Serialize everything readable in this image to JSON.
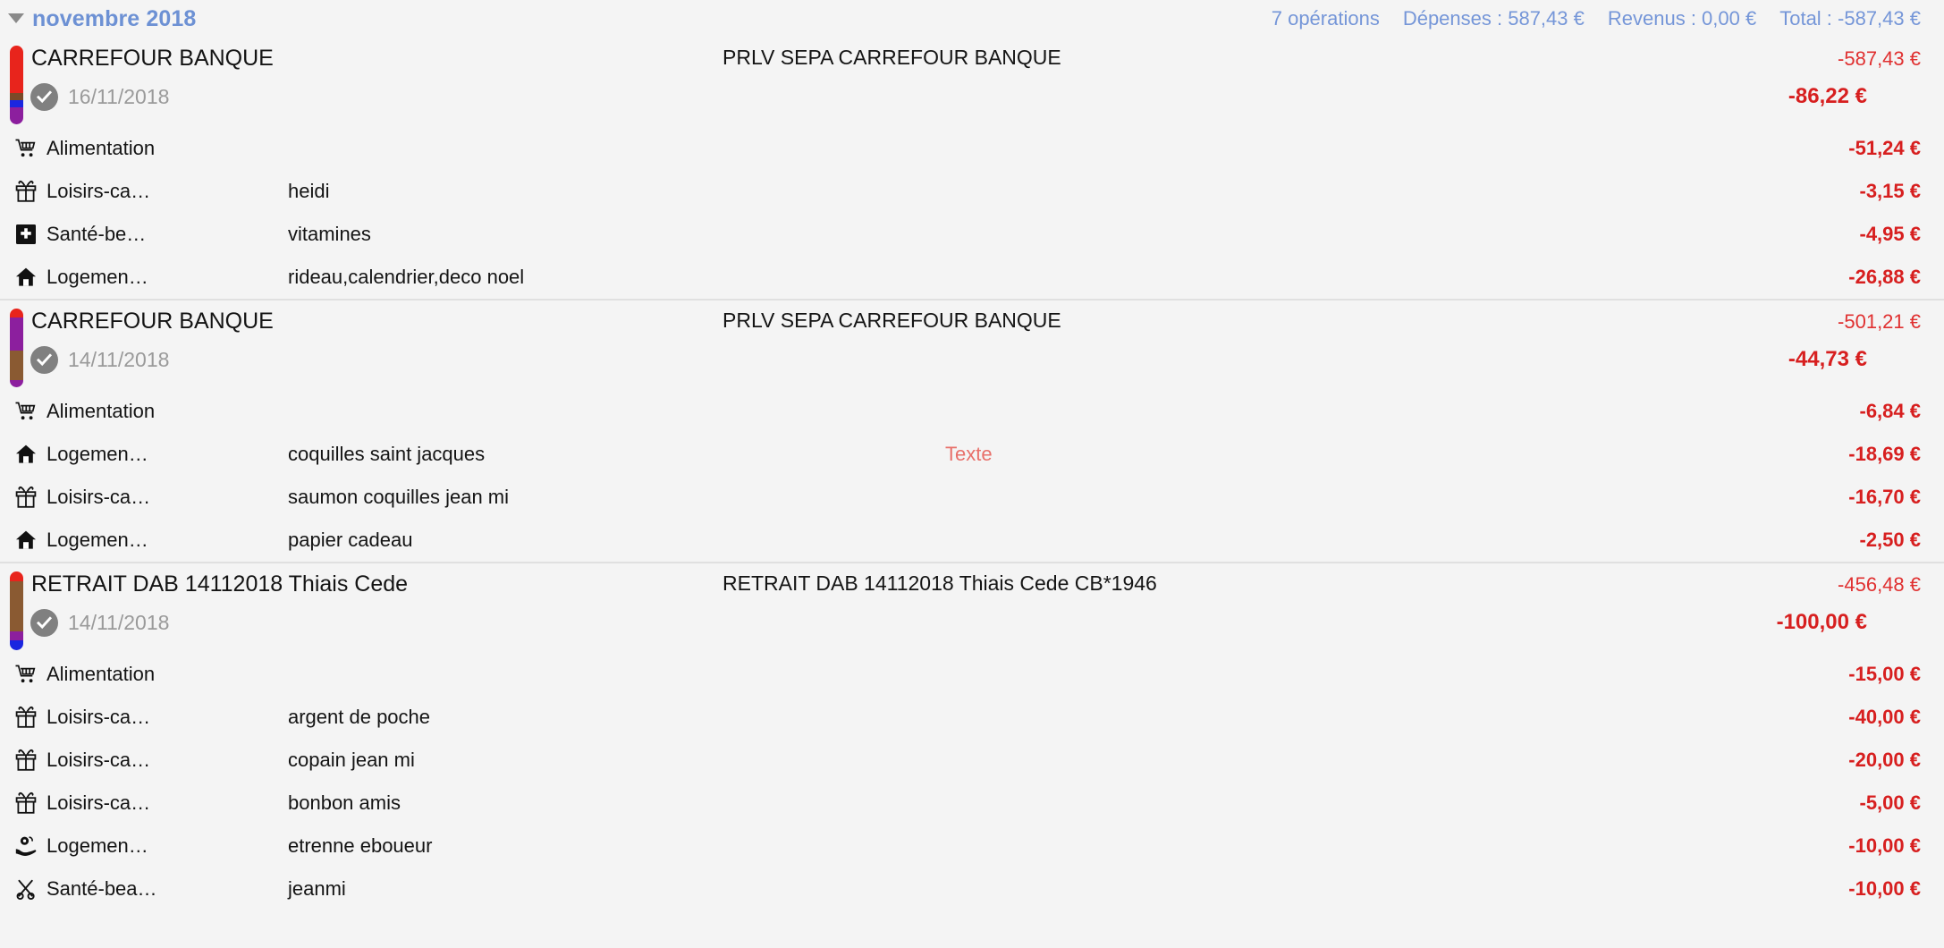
{
  "header": {
    "disclosure_icon": "triangle-down-icon",
    "month_label": "novembre 2018",
    "operations_count": "7 opérations",
    "expenses": "Dépenses : 587,43 €",
    "revenues": "Revenus : 0,00 €",
    "total": "Total : -587,43 €",
    "accent_color": "#7596d8"
  },
  "colors": {
    "background": "#f4f4f4",
    "negative_amount": "#d71f1f",
    "negative_amount_light": "#e03030",
    "date_text": "#9a9a9a",
    "separator": "#e0e0e0",
    "texte_marker": "#e8706a",
    "stripe_red": "#e8241c",
    "stripe_brown": "#8a5a32",
    "stripe_blue": "#1a26e0",
    "stripe_purple": "#8c1f9e"
  },
  "transactions": [
    {
      "label": "CARREFOUR BANQUE",
      "status_icon": "check-circle-icon",
      "date": "16/11/2018",
      "memo": "PRLV SEPA CARREFOUR BANQUE",
      "amount_top": "-587,43 €",
      "amount_main": "-86,22 €",
      "stripe": [
        {
          "color": "#e8241c",
          "pct": 60
        },
        {
          "color": "#7a4a28",
          "pct": 9
        },
        {
          "color": "#1a26e0",
          "pct": 9
        },
        {
          "color": "#8c1f9e",
          "pct": 22
        }
      ],
      "rows": [
        {
          "icon": "shopping-cart-icon",
          "category": "Alimentation",
          "note": "",
          "amount": "-51,24 €"
        },
        {
          "icon": "gift-icon",
          "category": "Loisirs-ca…",
          "note": "heidi",
          "amount": "-3,15 €"
        },
        {
          "icon": "medical-cross-icon",
          "category": "Santé-be…",
          "note": "vitamines",
          "amount": "-4,95 €"
        },
        {
          "icon": "house-icon",
          "category": "Logemen…",
          "note": "rideau,calendrier,deco noel",
          "amount": "-26,88 €"
        }
      ]
    },
    {
      "label": "CARREFOUR BANQUE",
      "status_icon": "check-circle-icon",
      "date": "14/11/2018",
      "memo": "PRLV SEPA CARREFOUR BANQUE",
      "amount_top": "-501,21 €",
      "amount_main": "-44,73 €",
      "stripe": [
        {
          "color": "#e8241c",
          "pct": 11
        },
        {
          "color": "#8c1f9e",
          "pct": 42
        },
        {
          "color": "#8a5a32",
          "pct": 38
        },
        {
          "color": "#8c1f9e",
          "pct": 9
        }
      ],
      "rows": [
        {
          "icon": "shopping-cart-icon",
          "category": "Alimentation",
          "note": "",
          "amount": "-6,84 €"
        },
        {
          "icon": "house-icon",
          "category": "Logemen…",
          "note": "coquilles saint jacques",
          "amount": "-18,69 €",
          "marker": "Texte"
        },
        {
          "icon": "gift-icon",
          "category": "Loisirs-ca…",
          "note": "saumon coquilles jean mi",
          "amount": "-16,70 €"
        },
        {
          "icon": "house-icon",
          "category": "Logemen…",
          "note": "papier cadeau",
          "amount": "-2,50 €"
        }
      ]
    },
    {
      "label": "RETRAIT DAB 14112018 Thiais Cede",
      "status_icon": "check-circle-icon",
      "date": "14/11/2018",
      "memo": "RETRAIT DAB 14112018 Thiais Cede CB*1946",
      "amount_top": "-456,48 €",
      "amount_main": "-100,00 €",
      "stripe": [
        {
          "color": "#e8241c",
          "pct": 12
        },
        {
          "color": "#8a5a32",
          "pct": 64
        },
        {
          "color": "#8c1f9e",
          "pct": 12
        },
        {
          "color": "#1a26e0",
          "pct": 12
        }
      ],
      "rows": [
        {
          "icon": "shopping-cart-icon",
          "category": "Alimentation",
          "note": "",
          "amount": "-15,00 €"
        },
        {
          "icon": "gift-icon",
          "category": "Loisirs-ca…",
          "note": "argent de poche",
          "amount": "-40,00 €"
        },
        {
          "icon": "gift-icon",
          "category": "Loisirs-ca…",
          "note": "copain jean mi",
          "amount": "-20,00 €"
        },
        {
          "icon": "gift-icon",
          "category": "Loisirs-ca…",
          "note": "bonbon amis",
          "amount": "-5,00 €"
        },
        {
          "icon": "hand-coin-icon",
          "category": "Logemen…",
          "note": "etrenne eboueur",
          "amount": "-10,00 €"
        },
        {
          "icon": "scissors-icon",
          "category": "Santé-bea…",
          "note": "jeanmi",
          "amount": "-10,00 €"
        }
      ]
    }
  ]
}
